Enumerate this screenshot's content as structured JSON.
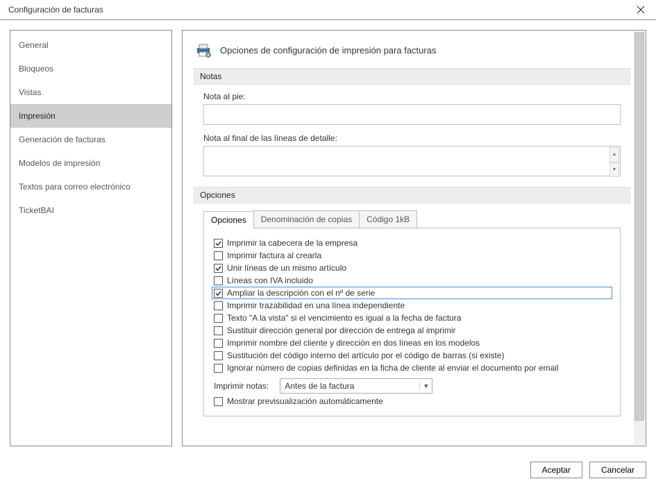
{
  "window": {
    "title": "Configuración de facturas"
  },
  "sidebar": {
    "items": [
      {
        "label": "General"
      },
      {
        "label": "Bloqueos"
      },
      {
        "label": "Vistas"
      },
      {
        "label": "Impresión",
        "selected": true
      },
      {
        "label": "Generación de facturas"
      },
      {
        "label": "Modelos de impresión"
      },
      {
        "label": "Textos para correo electrónico"
      },
      {
        "label": "TicketBAI"
      }
    ]
  },
  "main": {
    "header_title": "Opciones de configuración de impresión para facturas",
    "notas": {
      "section": "Notas",
      "footer_label": "Nota al pie:",
      "footer_value": "",
      "detail_label": "Nota al final de las líneas de detalle:",
      "detail_value": ""
    },
    "opciones": {
      "section": "Opciones",
      "tabs": [
        {
          "label": "Opciones",
          "active": true
        },
        {
          "label": "Denominación de copias"
        },
        {
          "label": "Código 1kB"
        }
      ],
      "checks": [
        {
          "label": "Imprimir la cabecera de la empresa",
          "checked": true
        },
        {
          "label": "Imprimir factura al crearla",
          "checked": false
        },
        {
          "label": "Unir líneas de un mismo artículo",
          "checked": true
        },
        {
          "label": "Líneas con IVA incluido",
          "checked": false
        },
        {
          "label": "Ampliar la descripción con el nº de serie",
          "checked": true,
          "highlight": true
        },
        {
          "label": "Imprimir trazabilidad en una línea independiente",
          "checked": false
        },
        {
          "label": "Texto \"A la vista\" si el vencimiento es igual a la fecha de factura",
          "checked": false
        },
        {
          "label": "Sustituir dirección general por dirección de entrega al imprimir",
          "checked": false
        },
        {
          "label": "Imprimir nombre del cliente y dirección en dos líneas en los modelos",
          "checked": false
        },
        {
          "label": "Sustitución del código interno del artículo por el código de barras (si existe)",
          "checked": false
        },
        {
          "label": "Ignorar número de copias definidas en la ficha de cliente al enviar el documento por email",
          "checked": false
        }
      ],
      "print_notes_label": "Imprimir notas:",
      "print_notes_value": "Antes de la factura",
      "preview_label": "Mostrar previsualización automáticamente",
      "preview_checked": false
    }
  },
  "footer": {
    "accept": "Aceptar",
    "cancel": "Cancelar"
  }
}
